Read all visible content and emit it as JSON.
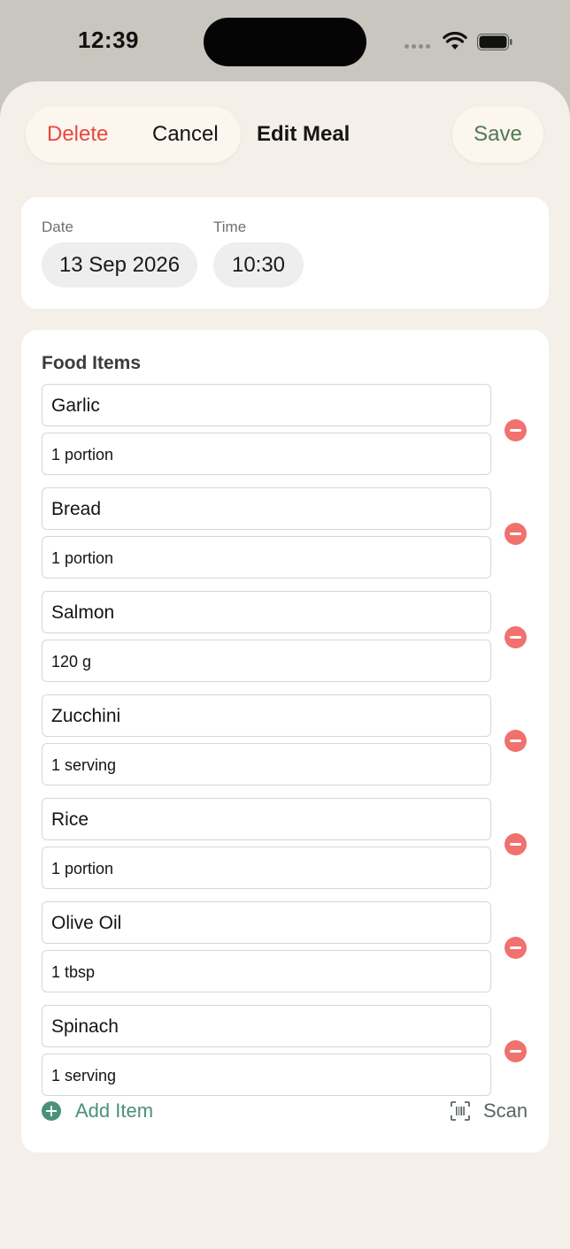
{
  "status": {
    "time": "12:39"
  },
  "header": {
    "delete_label": "Delete",
    "cancel_label": "Cancel",
    "title": "Edit Meal",
    "save_label": "Save"
  },
  "datetime": {
    "date_label": "Date",
    "date_value": "13 Sep 2026",
    "time_label": "Time",
    "time_value": "10:30"
  },
  "food": {
    "section_title": "Food Items",
    "items": [
      {
        "name": "Garlic",
        "quantity": "1 portion"
      },
      {
        "name": "Bread",
        "quantity": "1 portion"
      },
      {
        "name": "Salmon",
        "quantity": "120 g"
      },
      {
        "name": "Zucchini",
        "quantity": "1 serving"
      },
      {
        "name": "Rice",
        "quantity": "1 portion"
      },
      {
        "name": "Olive Oil",
        "quantity": "1 tbsp"
      },
      {
        "name": "Spinach",
        "quantity": "1 serving"
      }
    ],
    "add_label": "Add Item",
    "scan_label": "Scan"
  },
  "colors": {
    "accent_green": "#4a917c",
    "save_green": "#4f7a55",
    "delete_red": "#e8473f",
    "remove_red": "#f0716d",
    "sheet_bg": "#f4efe8"
  },
  "icons": [
    "wifi-icon",
    "battery-icon",
    "cellular-signal-icon",
    "remove-icon",
    "add-circle-icon",
    "barcode-scan-icon"
  ]
}
